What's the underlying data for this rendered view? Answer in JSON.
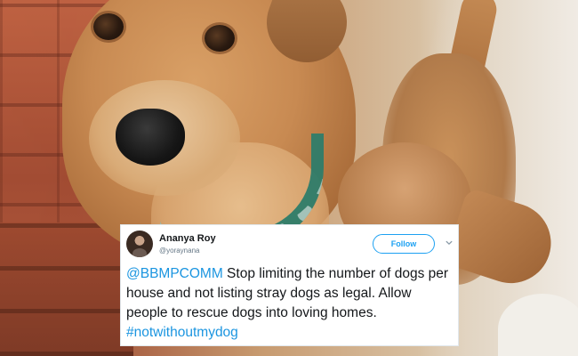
{
  "tweet": {
    "author_name": "Ananya Roy",
    "author_handle": "@yoraynana",
    "follow_label": "Follow",
    "text_mention": "@BBMPCOMM",
    "text_body": " Stop limiting the number of dogs per house and not listing stray dogs as legal. Allow people to rescue dogs into loving homes. ",
    "text_hashtag": "#notwithoutmydog"
  },
  "colors": {
    "link": "#1b95e0",
    "follow_accent": "#1da1f2",
    "text_primary": "#14171a",
    "text_secondary": "#657786"
  },
  "icons": {
    "chevron": "chevron-down-icon",
    "avatar": "avatar"
  }
}
